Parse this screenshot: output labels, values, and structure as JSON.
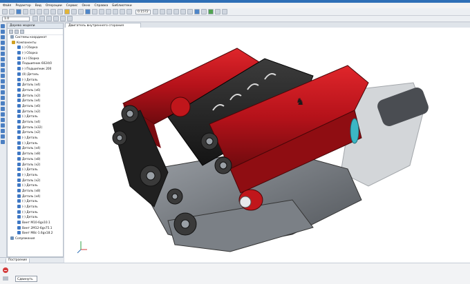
{
  "menu": [
    "Файл",
    "Редактор",
    "Вид",
    "Операции",
    "Сервис",
    "Окно",
    "Справка",
    "Библиотеки"
  ],
  "menu2": [
    "Файл",
    "Редактор",
    "Вид",
    "Операции",
    "Сервис",
    "Окно",
    "Справка",
    "Библиотеки"
  ],
  "toolbar": {
    "zoom_value": "0.1572",
    "field_value": "1.0"
  },
  "document": {
    "tab_title": "Двигатель внутреннего сгорания"
  },
  "tree": {
    "header": "Дерево модели",
    "items": [
      {
        "label": "Системы координат",
        "kind": "sys"
      },
      {
        "label": "Компоненты",
        "kind": "grp"
      },
      {
        "label": "(-) Сборка",
        "kind": "part"
      },
      {
        "label": "(-) Сборка",
        "kind": "part"
      },
      {
        "label": "(+) Сборка",
        "kind": "part"
      },
      {
        "label": "Подшипник 6024/0",
        "kind": "part"
      },
      {
        "label": "(-) Подшипник 200",
        "kind": "part"
      },
      {
        "label": "(0) Деталь",
        "kind": "part"
      },
      {
        "label": "(-) Деталь",
        "kind": "part"
      },
      {
        "label": "Деталь (x4)",
        "kind": "part"
      },
      {
        "label": "Деталь (x6)",
        "kind": "part"
      },
      {
        "label": "Деталь (x2)",
        "kind": "part"
      },
      {
        "label": "Деталь (x4)",
        "kind": "part"
      },
      {
        "label": "Деталь (x6)",
        "kind": "part"
      },
      {
        "label": "Деталь (x2)",
        "kind": "part"
      },
      {
        "label": "(-) Деталь",
        "kind": "part"
      },
      {
        "label": "Деталь (x4)",
        "kind": "part"
      },
      {
        "label": "Деталь (x32)",
        "kind": "part"
      },
      {
        "label": "Деталь (x2)",
        "kind": "part"
      },
      {
        "label": "(-) Деталь",
        "kind": "part"
      },
      {
        "label": "(-) Деталь",
        "kind": "part"
      },
      {
        "label": "Деталь (x4)",
        "kind": "part"
      },
      {
        "label": "Деталь (x8)",
        "kind": "part"
      },
      {
        "label": "Деталь (x8)",
        "kind": "part"
      },
      {
        "label": "Деталь (x2)",
        "kind": "part"
      },
      {
        "label": "(-) Деталь",
        "kind": "part"
      },
      {
        "label": "(-) Деталь",
        "kind": "part"
      },
      {
        "label": "Деталь (x2)",
        "kind": "part"
      },
      {
        "label": "(-) Деталь",
        "kind": "part"
      },
      {
        "label": "Деталь (x8)",
        "kind": "part"
      },
      {
        "label": "Деталь (x4)",
        "kind": "part"
      },
      {
        "label": "(-) Деталь",
        "kind": "part"
      },
      {
        "label": "(-) Деталь",
        "kind": "part"
      },
      {
        "label": "(-) Деталь",
        "kind": "part"
      },
      {
        "label": "(-) Деталь",
        "kind": "part"
      },
      {
        "label": "Винт M10-6gx10.1",
        "kind": "part"
      },
      {
        "label": "Винт 2M12-6gx75.1",
        "kind": "part"
      },
      {
        "label": "Винт M8с-1.6gx18.2",
        "kind": "part"
      },
      {
        "label": "Сопряжения",
        "kind": "mate"
      }
    ],
    "bottom_tab": "Построение"
  },
  "bottom": {
    "move_label": "Сдвинуть"
  },
  "colors": {
    "accent": "#2f6fb6",
    "engine_red": "#c0161b",
    "engine_dark": "#2a2a2a"
  }
}
